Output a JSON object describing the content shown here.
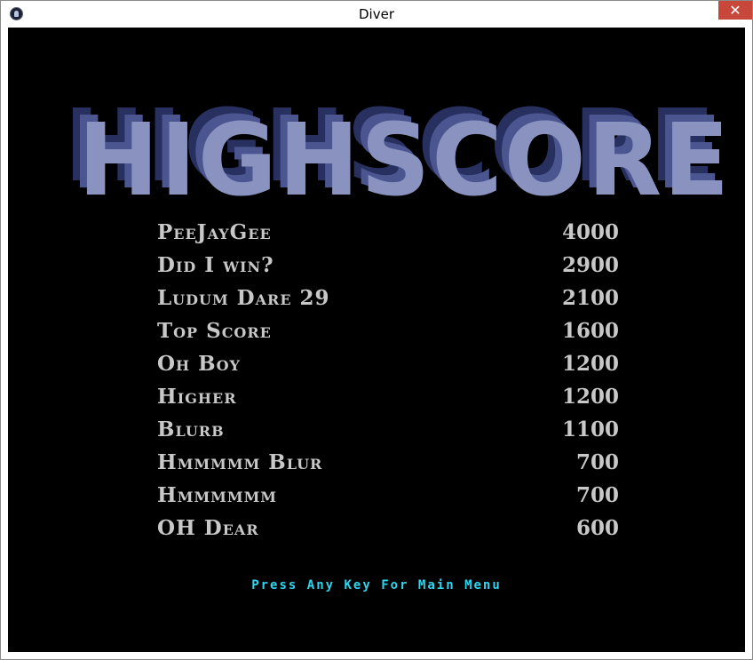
{
  "window": {
    "title": "Diver",
    "close_label": "✕"
  },
  "logo": {
    "text": "HIGHSCORE"
  },
  "highscores": [
    {
      "name": "PeeJayGee",
      "score": "4000"
    },
    {
      "name": "Did I win?",
      "score": "2900"
    },
    {
      "name": "Ludum Dare 29",
      "score": "2100"
    },
    {
      "name": "Top Score",
      "score": "1600"
    },
    {
      "name": "Oh Boy",
      "score": "1200"
    },
    {
      "name": "Higher",
      "score": "1200"
    },
    {
      "name": "Blurb",
      "score": "1100"
    },
    {
      "name": "Hmmmmm Blur",
      "score": "700"
    },
    {
      "name": "Hmmmmmm",
      "score": "700"
    },
    {
      "name": "OH Dear",
      "score": "600"
    }
  ],
  "prompt": "Press Any Key For Main Menu",
  "colors": {
    "background": "#000000",
    "logo_front": "#8a93c0",
    "logo_shadow_1": "#4b5590",
    "logo_shadow_2": "#283060",
    "score_text": "#c8c8c8",
    "prompt_text": "#2fd4ee",
    "close_button": "#c7473b"
  }
}
